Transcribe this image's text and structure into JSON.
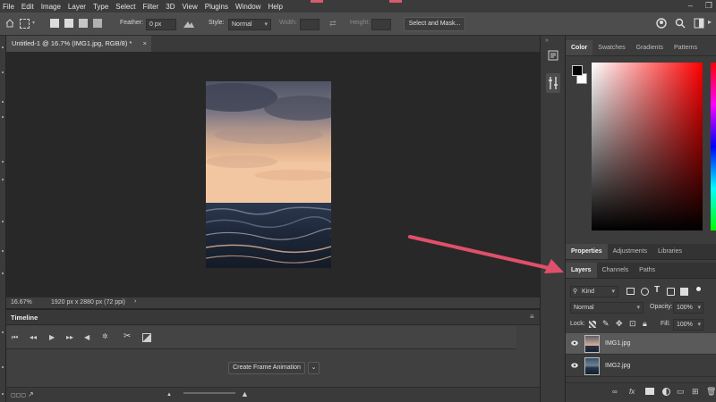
{
  "menu": [
    "File",
    "Edit",
    "Image",
    "Layer",
    "Type",
    "Select",
    "Filter",
    "3D",
    "View",
    "Plugins",
    "Window",
    "Help"
  ],
  "window_controls": [
    "–",
    "❐"
  ],
  "options": {
    "feather_label": "Feather:",
    "feather_value": "0 px",
    "style_label": "Style:",
    "style_value": "Normal",
    "width_label": "Width:",
    "height_label": "Height:",
    "select_mask_label": "Select and Mask..."
  },
  "document": {
    "tab_title": "Untitled-1 @ 16.7% (IMG1.jpg, RGB/8) *",
    "close": "×",
    "zoom": "16.67%",
    "dimensions": "1920 px x 2880 px (72 ppi)",
    "status_arrow": "›"
  },
  "timeline": {
    "title": "Timeline",
    "create_button": "Create Frame Animation"
  },
  "color_panel": {
    "tabs": [
      "Color",
      "Swatches",
      "Gradients",
      "Patterns"
    ],
    "foreground": "#000000",
    "background": "#ffffff"
  },
  "properties_panel": {
    "tabs": [
      "Properties",
      "Adjustments",
      "Libraries"
    ]
  },
  "layers_panel": {
    "tabs": [
      "Layers",
      "Channels",
      "Paths"
    ],
    "filter_kind": "Kind",
    "blend_mode": "Normal",
    "opacity_label": "Opacity:",
    "opacity_value": "100%",
    "lock_label": "Lock:",
    "fill_label": "Fill:",
    "fill_value": "100%",
    "layers": [
      {
        "name": "IMG1.jpg",
        "selected": true
      },
      {
        "name": "IMG2.jpg",
        "selected": false
      }
    ],
    "footer_icons": [
      "link-icon",
      "fx-icon",
      "mask-icon",
      "adjustment-icon",
      "folder-icon",
      "new-layer-icon",
      "trash-icon"
    ]
  },
  "annotation_arrow_color": "#e0506a"
}
